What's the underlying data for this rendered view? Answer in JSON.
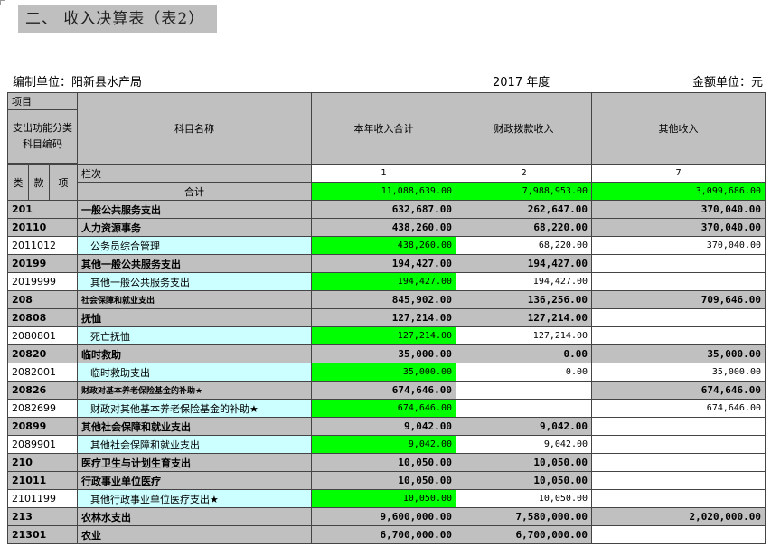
{
  "title": "二、 收入决算表（表2）",
  "info": {
    "unit": "编制单位：阳新县水产局",
    "year": "2017 年度",
    "money_unit": "金额单位：元"
  },
  "header": {
    "item": "项目",
    "func_code": "支出功能分类科目编码",
    "subject_name": "科目名称",
    "col_total": "本年收入合计",
    "col_fiscal": "财政拨款收入",
    "col_other": "其他收入",
    "lanci": "栏次",
    "lei": "类",
    "kuan": "款",
    "xiang": "项",
    "num1": "1",
    "num2": "2",
    "num7": "7"
  },
  "total_row": {
    "label": "合计",
    "total": "11,088,639.00",
    "fiscal": "7,988,953.00",
    "other": "3,099,686.00"
  },
  "rows": [
    {
      "code": "201",
      "name": "一般公共服务支出",
      "total": "632,687.00",
      "fiscal": "262,647.00",
      "other": "370,040.00"
    },
    {
      "code": "20110",
      "name": "人力资源事务",
      "total": "438,260.00",
      "fiscal": "68,220.00",
      "other": "370,040.00"
    },
    {
      "code": "2011012",
      "name": "公务员综合管理",
      "total": "438,260.00",
      "fiscal": "68,220.00",
      "other": "370,040.00"
    },
    {
      "code": "20199",
      "name": "其他一般公共服务支出",
      "total": "194,427.00",
      "fiscal": "194,427.00",
      "other": ""
    },
    {
      "code": "2019999",
      "name": "其他一般公共服务支出",
      "total": "194,427.00",
      "fiscal": "194,427.00",
      "other": ""
    },
    {
      "code": "208",
      "name": "社会保障和就业支出",
      "total": "845,902.00",
      "fiscal": "136,256.00",
      "other": "709,646.00"
    },
    {
      "code": "20808",
      "name": "抚恤",
      "total": "127,214.00",
      "fiscal": "127,214.00",
      "other": ""
    },
    {
      "code": "2080801",
      "name": "死亡抚恤",
      "total": "127,214.00",
      "fiscal": "127,214.00",
      "other": ""
    },
    {
      "code": "20820",
      "name": "临时救助",
      "total": "35,000.00",
      "fiscal": "0.00",
      "other": "35,000.00"
    },
    {
      "code": "2082001",
      "name": "临时救助支出",
      "total": "35,000.00",
      "fiscal": "0.00",
      "other": "35,000.00"
    },
    {
      "code": "20826",
      "name": "财政对基本养老保险基金的补助★",
      "total": "674,646.00",
      "fiscal": "",
      "other": "674,646.00"
    },
    {
      "code": "2082699",
      "name": "财政对其他基本养老保险基金的补助★",
      "total": "674,646.00",
      "fiscal": "",
      "other": "674,646.00"
    },
    {
      "code": "20899",
      "name": "其他社会保障和就业支出",
      "total": "9,042.00",
      "fiscal": "9,042.00",
      "other": ""
    },
    {
      "code": "2089901",
      "name": "其他社会保障和就业支出",
      "total": "9,042.00",
      "fiscal": "9,042.00",
      "other": ""
    },
    {
      "code": "210",
      "name": "医疗卫生与计划生育支出",
      "total": "10,050.00",
      "fiscal": "10,050.00",
      "other": ""
    },
    {
      "code": "21011",
      "name": "行政事业单位医疗",
      "total": "10,050.00",
      "fiscal": "10,050.00",
      "other": ""
    },
    {
      "code": "2101199",
      "name": "其他行政事业单位医疗支出★",
      "total": "10,050.00",
      "fiscal": "10,050.00",
      "other": ""
    },
    {
      "code": "213",
      "name": "农林水支出",
      "total": "9,600,000.00",
      "fiscal": "7,580,000.00",
      "other": "2,020,000.00"
    },
    {
      "code": "21301",
      "name": "农业",
      "total": "6,700,000.00",
      "fiscal": "6,700,000.00",
      "other": ""
    }
  ]
}
